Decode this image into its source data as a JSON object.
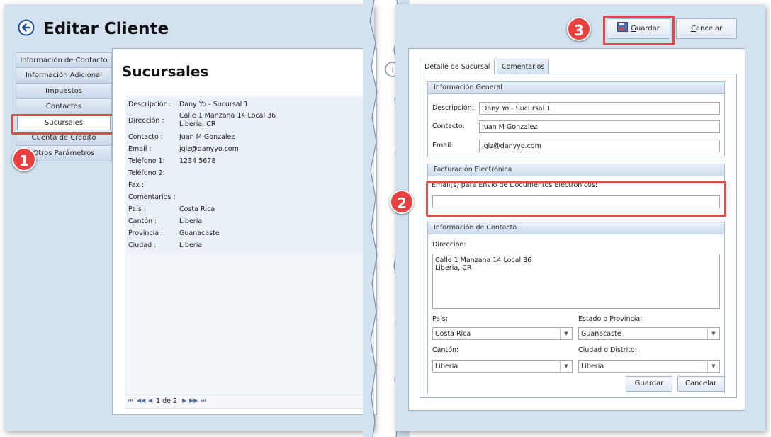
{
  "left": {
    "title": "Editar Cliente",
    "nav": [
      {
        "label": "Información de Contacto"
      },
      {
        "label": "Información Adicional"
      },
      {
        "label": "Impuestos"
      },
      {
        "label": "Contactos"
      },
      {
        "label": "Sucursales"
      },
      {
        "label": "Cuenta de Crédito"
      },
      {
        "label": "Otros Parámetros"
      }
    ],
    "content_title": "Sucursales",
    "branch": {
      "descripcion_label": "Descripción :",
      "descripcion": "Dany Yo - Sucursal 1",
      "direccion_label": "Dirección :",
      "direccion_line1": "Calle 1 Manzana 14  Local 36",
      "direccion_line2": "Liberia, CR",
      "contacto_label": "Contacto :",
      "contacto": "Juan M Gonzalez",
      "email_label": "Email :",
      "email": "jglz@danyyo.com",
      "telefono1_label": "Teléfono 1:",
      "telefono1": "1234 5678",
      "telefono2_label": "Teléfono 2:",
      "fax_label": "Fax :",
      "comentarios_label": "Comentarios :",
      "pais_label": "País :",
      "pais": "Costa Rica",
      "canton_label": "Cantón :",
      "canton": "Liberia",
      "provincia_label": "Provincia :",
      "provincia": "Guanacaste",
      "ciudad_label": "Ciudad :",
      "ciudad": "Liberia"
    },
    "pager": {
      "text": "1 de 2"
    }
  },
  "right": {
    "toolbar": {
      "save_prefix": "G",
      "save_rest": "uardar",
      "cancel_prefix": "C",
      "cancel_rest": "ancelar"
    },
    "tabs": [
      {
        "label": "Detalle de Sucursal"
      },
      {
        "label": "Comentarios"
      }
    ],
    "general": {
      "header": "Información General",
      "descripcion_label": "Descripción:",
      "descripcion": "Dany Yo - Sucursal 1",
      "contacto_label": "Contacto:",
      "contacto": "Juan M Gonzalez",
      "email_label": "Email:",
      "email": "jglz@danyyo.com"
    },
    "fe": {
      "header": "Facturación Electrónica",
      "emails_label": "Email(s) para Envío de Documentos Electrónicos:",
      "emails_value": ""
    },
    "contacto": {
      "header": "Información de Contacto",
      "direccion_label": "Dirección:",
      "direccion": "Calle 1 Manzana 14  Local 36\nLiberia, CR",
      "pais_label": "País:",
      "pais": "Costa Rica",
      "provincia_label": "Estado o Provincia:",
      "provincia": "Guanacaste",
      "canton_label": "Cantón:",
      "canton": "Liberia",
      "ciudad_label": "Ciudad o Distrito:",
      "ciudad": "Liberia"
    },
    "bottom": {
      "save": "Guardar",
      "cancel": "Cancelar"
    }
  },
  "badges": {
    "b1": "1",
    "b2": "2",
    "b3": "3"
  },
  "colors": {
    "panel_bg": "#d3e1f1",
    "highlight_red": "#e04a48",
    "badge_red": "#e8413f"
  }
}
